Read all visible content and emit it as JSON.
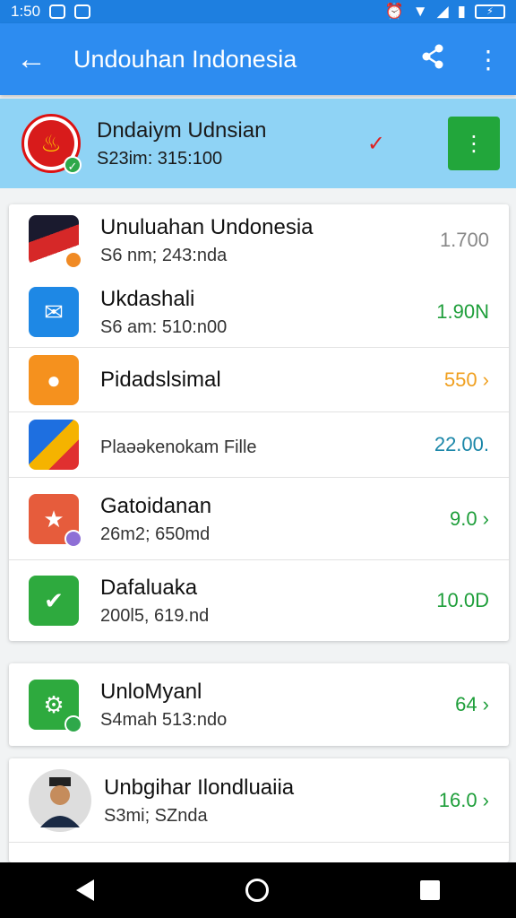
{
  "status": {
    "time": "1:50",
    "battery": "⚡"
  },
  "appbar": {
    "back_icon": "arrow-left-icon",
    "title": "Undouhan Indonesia",
    "share_icon": "share-icon",
    "more_icon": "more-vert-icon"
  },
  "account": {
    "name": "Dndaiym Udnsian",
    "sub": "S23im: 315:100",
    "menu_icon": "more-vert-icon"
  },
  "groups": [
    {
      "items": [
        {
          "title": "Unuluahan Undonesia",
          "sub": "S6 nm; 243:nda",
          "value": "1.700",
          "color": "#888888",
          "icon": "flag-file-icon"
        },
        {
          "title": "Ukdashali",
          "sub": "S6 am: 510:n00",
          "value": "1.90N",
          "color": "#1e9e3a",
          "icon": "mail-icon"
        }
      ]
    },
    {
      "items": [
        {
          "title": "Pidadslsimal",
          "sub": "",
          "value": "550 ›",
          "color": "#f0a020",
          "icon": "orange-app-icon"
        },
        {
          "title": "",
          "sub": "Plaəəkenokam Fille",
          "value": "22.00.",
          "color": "#1a86a8",
          "icon": "pen-icon"
        }
      ]
    },
    {
      "items": [
        {
          "title": "Gatoidanan",
          "sub": "26m2; 650md",
          "value": "9.0 ›",
          "color": "#1e9e3a",
          "icon": "star-folder-icon"
        },
        {
          "title": "Dafaluaka",
          "sub": "200l5, 619.nd",
          "value": "10.0D",
          "color": "#1e9e3a",
          "icon": "check-folder-icon"
        }
      ]
    },
    {
      "items": [
        {
          "title": "UnloMyanl",
          "sub": "S4mah 513:ndo",
          "value": "64 ›",
          "color": "#1e9e3a",
          "icon": "gear-icon"
        }
      ]
    },
    {
      "items": [
        {
          "title": "Unbgihar Ilondluaiia",
          "sub": "S3mi; SZnda",
          "value": "16.0 ›",
          "color": "#1e9e3a",
          "icon": "avatar-photo-icon"
        }
      ]
    }
  ],
  "nav": {
    "back": "back-triangle-icon",
    "home": "home-circle-icon",
    "recents": "recents-square-icon"
  }
}
